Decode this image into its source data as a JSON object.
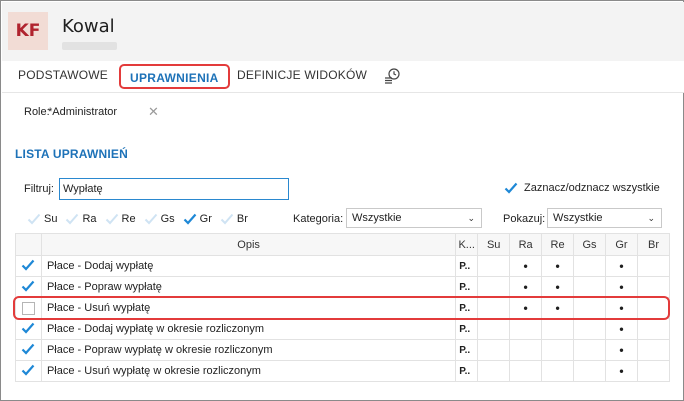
{
  "header": {
    "initials": "KF",
    "name": "Kowal"
  },
  "tabs": [
    {
      "label": "PODSTAWOWE"
    },
    {
      "label": "UPRAWNIENIA"
    },
    {
      "label": "DEFINICJE WIDOKÓW"
    }
  ],
  "role": {
    "label": "Role:",
    "value": "*Administrator"
  },
  "section_title": "LISTA UPRAWNIEŃ",
  "filter": {
    "label": "Filtruj:",
    "value": "Wypłatę"
  },
  "check_all_label": "Zaznacz/odznacz wszystkie",
  "perms": [
    {
      "label": "Su",
      "checked": false
    },
    {
      "label": "Ra",
      "checked": false
    },
    {
      "label": "Re",
      "checked": false
    },
    {
      "label": "Gs",
      "checked": false
    },
    {
      "label": "Gr",
      "checked": true
    },
    {
      "label": "Br",
      "checked": false
    }
  ],
  "category": {
    "label": "Kategoria:",
    "value": "Wszystkie"
  },
  "show": {
    "label": "Pokazuj:",
    "value": "Wszystkie"
  },
  "table": {
    "headers": {
      "desc": "Opis",
      "k": "K...",
      "su": "Su",
      "ra": "Ra",
      "re": "Re",
      "gs": "Gs",
      "gr": "Gr",
      "br": "Br"
    },
    "rows": [
      {
        "checked": true,
        "desc": "Płace - Dodaj wypłatę",
        "k": "P..",
        "su": "",
        "ra": "•",
        "re": "•",
        "gs": "",
        "gr": "•",
        "br": ""
      },
      {
        "checked": true,
        "desc": "Płace - Popraw wypłatę",
        "k": "P..",
        "su": "",
        "ra": "•",
        "re": "•",
        "gs": "",
        "gr": "•",
        "br": ""
      },
      {
        "checked": false,
        "desc": "Płace - Usuń wypłatę",
        "k": "P..",
        "su": "",
        "ra": "•",
        "re": "•",
        "gs": "",
        "gr": "•",
        "br": ""
      },
      {
        "checked": true,
        "desc": "Płace - Dodaj wypłatę w okresie rozliczonym",
        "k": "P..",
        "su": "",
        "ra": "",
        "re": "",
        "gs": "",
        "gr": "•",
        "br": ""
      },
      {
        "checked": true,
        "desc": "Płace - Popraw wypłatę w okresie rozliczonym",
        "k": "P..",
        "su": "",
        "ra": "",
        "re": "",
        "gs": "",
        "gr": "•",
        "br": ""
      },
      {
        "checked": true,
        "desc": "Płace - Usuń wypłatę w okresie rozliczonym",
        "k": "P..",
        "su": "",
        "ra": "",
        "re": "",
        "gs": "",
        "gr": "•",
        "br": ""
      }
    ]
  },
  "colors": {
    "accent": "#1d72b8",
    "highlight": "#e33b3b",
    "check": "#1e88d6"
  }
}
